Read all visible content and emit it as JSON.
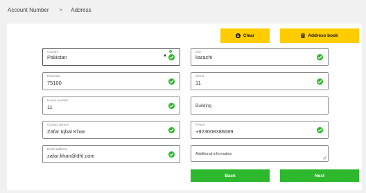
{
  "breadcrumb": {
    "items": [
      "Account Number",
      "Address"
    ],
    "separator": ">"
  },
  "actions": {
    "clear_label": "Clear",
    "address_book_label": "Address book",
    "back_label": "Back",
    "next_label": "Next"
  },
  "form": {
    "country": {
      "label": "Country",
      "value": "Pakistan",
      "valid": true
    },
    "city": {
      "label": "City",
      "value": "karachi",
      "valid": true
    },
    "postcode": {
      "label": "Postcode",
      "value": "75100",
      "valid": true
    },
    "street": {
      "label": "Street",
      "value": "11",
      "valid": true
    },
    "house_number": {
      "label": "House number",
      "value": "11",
      "valid": true
    },
    "building": {
      "placeholder": "Building",
      "value": ""
    },
    "contact_person": {
      "label": "Contact person",
      "value": "Zafar Iqbal Khan",
      "valid": true
    },
    "phone": {
      "label": "Phone",
      "value": "+923008386689",
      "valid": true
    },
    "email": {
      "label": "Email address",
      "value": "zafar.khan@dhl.com",
      "valid": true
    },
    "additional_information": {
      "placeholder": "Additional information",
      "value": ""
    }
  },
  "colors": {
    "accent_yellow": "#ffcc00",
    "success_green": "#2eb82e",
    "background": "#f1f1f1"
  },
  "icons": [
    "close-circle-icon",
    "address-book-icon",
    "check-circle-icon",
    "dropdown-caret-icon",
    "resize-handle-icon"
  ]
}
